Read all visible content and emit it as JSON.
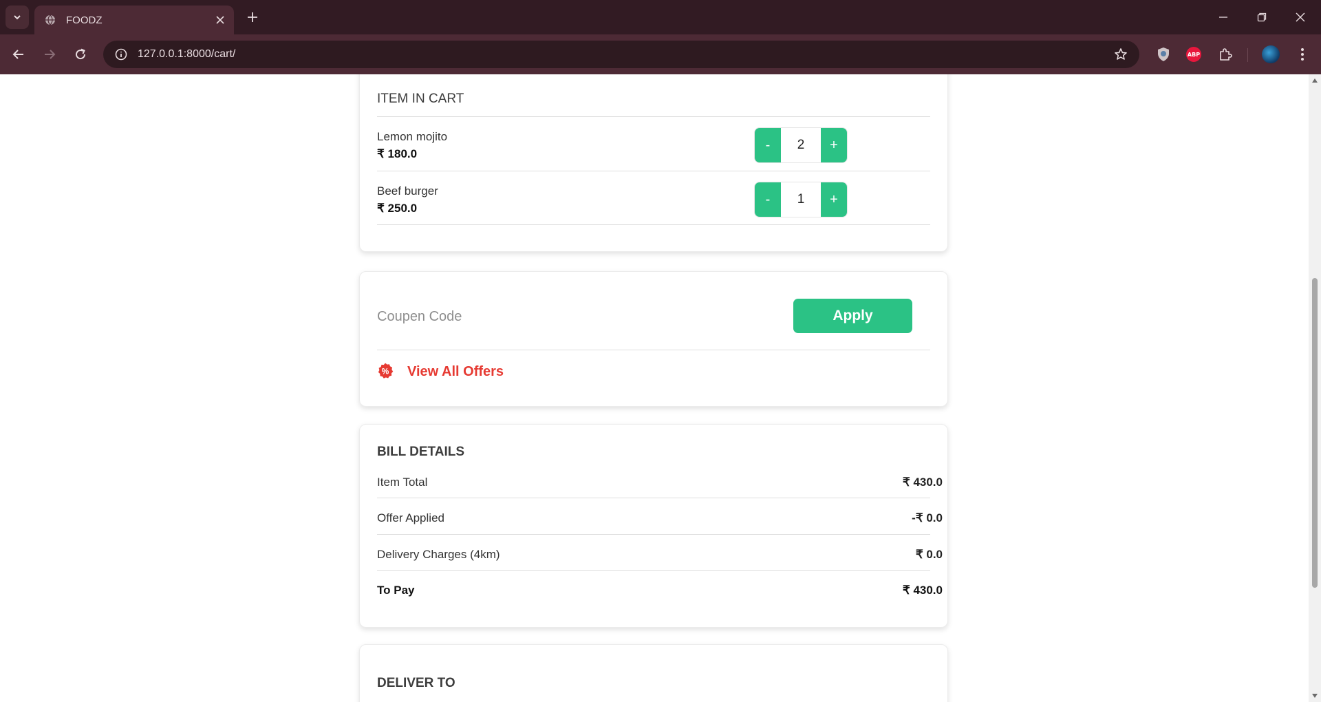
{
  "browser": {
    "tab_title": "FOODZ",
    "url": "127.0.0.1:8000/cart/",
    "extension_abp_label": "ABP"
  },
  "cart": {
    "title": "ITEM IN CART",
    "items": [
      {
        "name": "Lemon mojito",
        "price": "₹ 180.0",
        "quantity": "2",
        "minus": "-",
        "plus": "+"
      },
      {
        "name": "Beef burger",
        "price": "₹ 250.0",
        "quantity": "1",
        "minus": "-",
        "plus": "+"
      }
    ]
  },
  "coupon": {
    "placeholder": "Coupen Code",
    "apply_label": "Apply",
    "offers_label": "View All Offers",
    "offers_icon_glyph": "%"
  },
  "bill": {
    "title": "BILL DETAILS",
    "rows": [
      {
        "label": "Item Total",
        "value": "₹ 430.0"
      },
      {
        "label": "Offer Applied",
        "value": "-₹ 0.0"
      },
      {
        "label": "Delivery Charges (4km)",
        "value": "₹ 0.0"
      },
      {
        "label": "To Pay",
        "value": "₹ 430.0"
      }
    ]
  },
  "deliver": {
    "title": "DELIVER TO"
  },
  "colors": {
    "accent_green": "#2bc285",
    "offer_red": "#e63a32",
    "chrome_dark": "#321b23",
    "chrome_toolbar": "#4d2a35"
  },
  "icons": [
    "tab-search-icon",
    "globe-icon",
    "close-icon",
    "plus-icon",
    "minimize-icon",
    "restore-icon",
    "back-icon",
    "forward-icon",
    "reload-icon",
    "info-icon",
    "star-icon",
    "shield-icon",
    "puzzle-icon",
    "offer-percent-icon"
  ]
}
